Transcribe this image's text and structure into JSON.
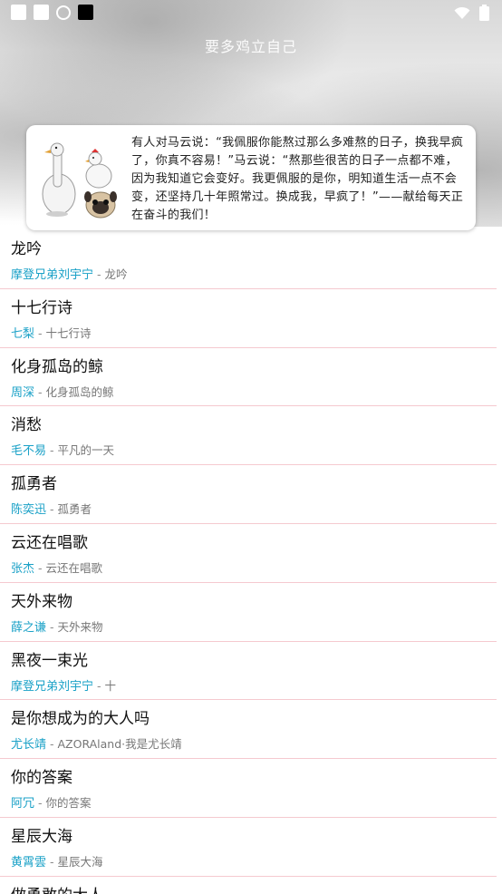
{
  "status_bar": {
    "icons": [
      "notification-square-icon",
      "notification-square-icon",
      "sync-icon",
      "black-square-icon",
      "wifi-icon",
      "battery-icon"
    ]
  },
  "header": {
    "title": "要多鸡立自己"
  },
  "quote_card": {
    "text": "有人对马云说：“我佩服你能熬过那么多难熬的日子，换我早疯了，你真不容易！”马云说：“熬那些很苦的日子一点都不难，因为我知道它会变好。我更佩服的是你，明知道生活一点不会变，还坚持几十年照常过。换成我，早疯了！”——献给每天正在奋斗的我们！",
    "image": "goose-and-pug-illustration"
  },
  "songs": [
    {
      "title": "龙吟",
      "artist": "摩登兄弟刘宇宁",
      "separator": " - ",
      "album": "龙吟"
    },
    {
      "title": "十七行诗",
      "artist": "七梨",
      "separator": " - ",
      "album": "十七行诗"
    },
    {
      "title": "化身孤岛的鲸",
      "artist": "周深",
      "separator": " - ",
      "album": "化身孤岛的鲸"
    },
    {
      "title": "消愁",
      "artist": "毛不易",
      "separator": " - ",
      "album": "平凡的一天"
    },
    {
      "title": "孤勇者",
      "artist": "陈奕迅",
      "separator": " - ",
      "album": "孤勇者"
    },
    {
      "title": "云还在唱歌",
      "artist": "张杰",
      "separator": " - ",
      "album": "云还在唱歌"
    },
    {
      "title": "天外来物",
      "artist": "薛之谦",
      "separator": " - ",
      "album": "天外来物"
    },
    {
      "title": "黑夜一束光",
      "artist": "摩登兄弟刘宇宁",
      "separator": " - ",
      "album": "十"
    },
    {
      "title": "是你想成为的大人吗",
      "artist": "尤长靖",
      "separator": " - ",
      "album": "AZORAland·我是尤长靖"
    },
    {
      "title": "你的答案",
      "artist": "阿冗",
      "separator": " - ",
      "album": "你的答案"
    },
    {
      "title": "星辰大海",
      "artist": "黄霄雲",
      "separator": " - ",
      "album": "星辰大海"
    },
    {
      "title": "做勇敢的大人",
      "artist": "",
      "separator": "",
      "album": ""
    }
  ],
  "colors": {
    "artist": "#1aa1c7",
    "divider": "#f5c9cf",
    "title": "#111111"
  }
}
